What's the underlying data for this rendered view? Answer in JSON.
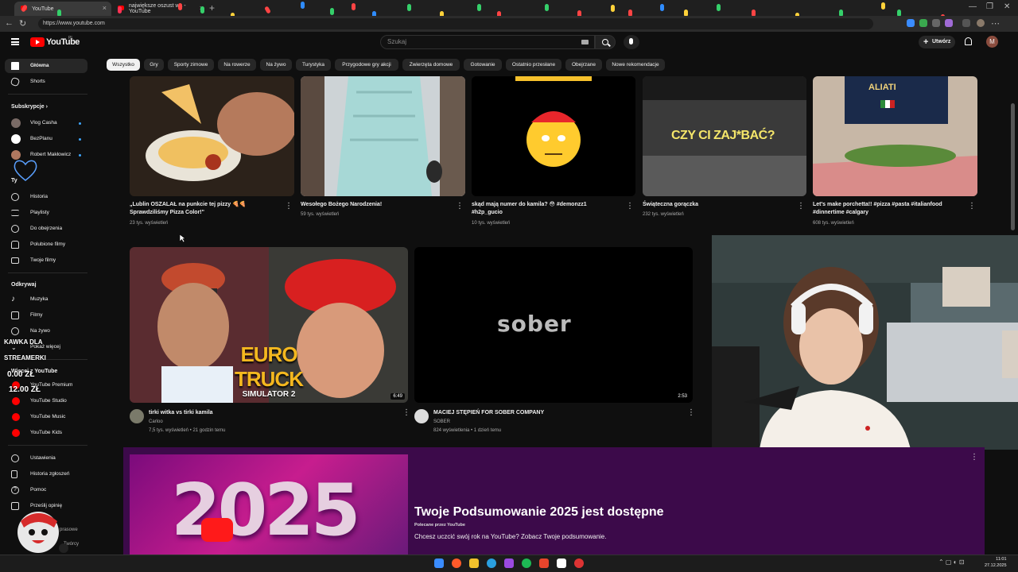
{
  "browser": {
    "tabs": [
      {
        "label": "YouTube"
      },
      {
        "label": "największe oszust wa - YouTube"
      }
    ],
    "url": "https://www.youtube.com"
  },
  "header": {
    "logo_text": "YouTube",
    "region": "PL",
    "search_placeholder": "Szukaj",
    "create_label": "Utwórz",
    "avatar_letter": "M"
  },
  "chips": [
    {
      "label": "Wszystko"
    },
    {
      "label": "Gry"
    },
    {
      "label": "Sporty zimowe"
    },
    {
      "label": "Na rowerze"
    },
    {
      "label": "Na żywo"
    },
    {
      "label": "Turystyka"
    },
    {
      "label": "Przygodowe gry akcji"
    },
    {
      "label": "Zwierzęta domowe"
    },
    {
      "label": "Gotowanie"
    },
    {
      "label": "Ostatnio przesłane"
    },
    {
      "label": "Obejrzane"
    },
    {
      "label": "Nowe rekomendacje"
    }
  ],
  "sidebar": {
    "main": [
      {
        "label": "Główna",
        "icon": "home-icon"
      },
      {
        "label": "Shorts",
        "icon": "shorts-icon"
      }
    ],
    "subs_heading": "Subskrypcje",
    "subs": [
      {
        "label": "Vlog Casha"
      },
      {
        "label": "BezPlanu"
      },
      {
        "label": "Robert Makłowicz"
      }
    ],
    "you_heading": "Ty",
    "you": [
      {
        "label": "Historia",
        "icon": "history-icon"
      },
      {
        "label": "Playlisty",
        "icon": "playlist-icon"
      },
      {
        "label": "Do obejrzenia",
        "icon": "watch-later-icon"
      },
      {
        "label": "Polubione filmy",
        "icon": "like-icon"
      },
      {
        "label": "Twoje filmy",
        "icon": "your-videos-icon"
      }
    ],
    "explore_heading": "Odkrywaj",
    "explore": [
      {
        "label": "Muzyka",
        "icon": "music-icon"
      },
      {
        "label": "Filmy",
        "icon": "film-icon"
      },
      {
        "label": "Na żywo",
        "icon": "live-icon"
      },
      {
        "label": "Pokaż więcej",
        "icon": "chevron-down-icon"
      }
    ],
    "more_heading": "Więcej z YouTube",
    "more": [
      {
        "label": "YouTube Premium"
      },
      {
        "label": "YouTube Studio"
      },
      {
        "label": "YouTube Music"
      },
      {
        "label": "YouTube Kids"
      }
    ],
    "settings": [
      {
        "label": "Ustawienia",
        "icon": "gear-icon"
      },
      {
        "label": "Historia zgłoszeń",
        "icon": "flag-icon"
      },
      {
        "label": "Pomoc",
        "icon": "help-icon"
      },
      {
        "label": "Prześlij opinię",
        "icon": "feedback-icon"
      }
    ],
    "footer": [
      "prasowe",
      "Twórcy"
    ]
  },
  "videos_row1": [
    {
      "title_l1": "„Lublin OSZALAŁ na punkcie tej pizzy 🍕🍕",
      "title_l2": "Sprawdziliśmy Pizza Color!\"",
      "meta": "23 tys. wyświetleń"
    },
    {
      "title_l1": "Wesołego Bożego Narodzenia!",
      "title_l2": "",
      "meta": "59 tys. wyświetleń"
    },
    {
      "title_l1": "skąd mają numer do kamila? 😳 #demonzz1",
      "title_l2": "#h2p_gucio",
      "meta": "10 tys. wyświetleń"
    },
    {
      "title_l1": "Świąteczna gorączka",
      "title_l2": "",
      "meta": "232 tys. wyświetleń"
    },
    {
      "title_l1": "Let's make porchetta!! #pizza #pasta #italianfood",
      "title_l2": "#dinnertime #calgary",
      "meta": "608 tys. wyświetleń"
    }
  ],
  "thumb_texts": {
    "zaj": "CZY CI ZAJ*BAĆ?",
    "ets_line1": "EURO TRUCK",
    "ets_line2": "SIMULATOR 2",
    "sober": "sober",
    "aliati": "ALIATI",
    "recap_year": "2025"
  },
  "videos_row2": [
    {
      "title": "tirki witka vs tirki kamila",
      "channel": "Carloo",
      "meta": "7,5 tys. wyświetleń • 21 godzin temu",
      "duration": "6:49"
    },
    {
      "title": "MACIEJ STĘPIEŃ FOR SOBER COMPANY",
      "channel": "SOBER",
      "meta": "824 wyświetlenia • 1 dzień temu",
      "duration": "2:53"
    }
  ],
  "recap": {
    "title": "Twoje Podsumowanie 2025 jest dostępne",
    "sponsor": "Polecane przez YouTube",
    "desc": "Chcesz uczcić swój rok na YouTube? Zobacz Twoje podsumowanie."
  },
  "overlay": {
    "kawka": [
      "KAWKA DLA",
      "STREAMERKI"
    ],
    "amount1": "0.00 ZŁ",
    "amount2": "12.00 ZŁ"
  },
  "clock": {
    "time": "11:01",
    "date": "27.12.2025"
  },
  "colors": {
    "background": "#0f0f0f",
    "chip": "#272727",
    "accent": "#ff0000",
    "recap_bg": "#3c0a4a"
  }
}
